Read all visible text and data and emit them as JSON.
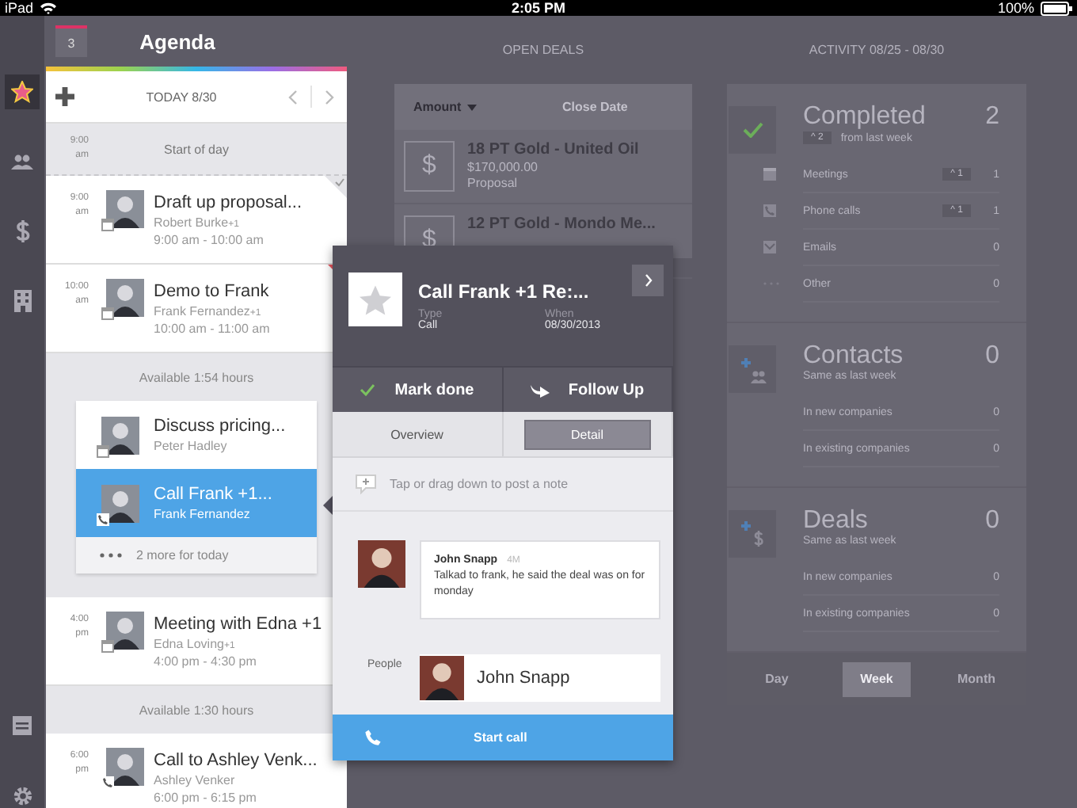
{
  "status_bar": {
    "device": "iPad",
    "time": "2:05 PM",
    "battery": "100%"
  },
  "nav_top": [
    {
      "kind": "star",
      "selected": true
    },
    {
      "kind": "contacts",
      "selected": false
    },
    {
      "kind": "dollar",
      "selected": false
    },
    {
      "kind": "building",
      "selected": false
    }
  ],
  "nav_bottom": [
    {
      "kind": "notes",
      "selected": false
    },
    {
      "kind": "settings",
      "selected": false
    }
  ],
  "agenda": {
    "badge": "3",
    "title": "Agenda",
    "date": "TODAY 8/30",
    "entries": [
      {
        "kind": "slot",
        "hour": "9:00",
        "period": "am",
        "text": "Start of day"
      },
      {
        "kind": "meeting",
        "hour": "9:00",
        "period": "am",
        "title": "Draft up proposal...",
        "person": "Robert Burke",
        "extra": "+1",
        "range": "9:00 am - 10:00 am",
        "done": true,
        "flagged": false
      },
      {
        "kind": "meeting",
        "hour": "10:00",
        "period": "am",
        "title": "Demo to Frank",
        "person": "Frank Fernandez",
        "extra": "+1",
        "range": "10:00 am - 11:00 am",
        "done": false,
        "flagged": true
      },
      {
        "kind": "available",
        "text": "Available 1:54 hours"
      },
      {
        "kind": "group",
        "items": [
          {
            "kind": "meeting",
            "title": "Discuss pricing...",
            "person": "Peter Hadley",
            "selected": false
          },
          {
            "kind": "call",
            "title": "Call Frank +1...",
            "person": "Frank Fernandez",
            "selected": true
          }
        ],
        "more": "2 more for today"
      },
      {
        "kind": "meeting",
        "hour": "4:00",
        "period": "pm",
        "title": "Meeting with Edna +1",
        "person": "Edna Loving",
        "extra": "+1",
        "range": "4:00 pm - 4:30 pm",
        "done": false,
        "flagged": false
      },
      {
        "kind": "available",
        "text": "Available 1:30 hours"
      },
      {
        "kind": "call",
        "hour": "6:00",
        "period": "pm",
        "title": "Call to Ashley Venk...",
        "person": "Ashley Venker",
        "range": "6:00 pm - 6:15 pm",
        "done": false,
        "flagged": false
      }
    ]
  },
  "open_deals": {
    "title": "OPEN DEALS",
    "columns": [
      {
        "label": "Amount",
        "sorted": true
      },
      {
        "label": "Close Date",
        "sorted": false
      }
    ],
    "rows": [
      {
        "icon": "$",
        "title": "18 PT Gold - United Oil",
        "amount": "$170,000.00",
        "stage": "Proposal"
      },
      {
        "icon": "$",
        "title": "12 PT Gold - Mondo Me..."
      }
    ]
  },
  "activity": {
    "title": "ACTIVITY 08/25 - 08/30",
    "sections": [
      {
        "kind": "completed",
        "title": "Completed",
        "count": "2",
        "change": "^ 2",
        "note": "from last week",
        "rows": [
          {
            "label": "Meetings",
            "change": "^ 1",
            "count": "1"
          },
          {
            "label": "Phone calls",
            "change": "^ 1",
            "count": "1"
          },
          {
            "label": "Emails",
            "count": "0"
          },
          {
            "label": "Other",
            "count": "0"
          }
        ]
      },
      {
        "kind": "contacts",
        "title": "Contacts",
        "count": "0",
        "note": "Same as last week",
        "rows": [
          {
            "label": "In new companies",
            "count": "0"
          },
          {
            "label": "In existing companies",
            "count": "0"
          }
        ]
      },
      {
        "kind": "deals",
        "title": "Deals",
        "count": "0",
        "note": "Same as last week",
        "rows": [
          {
            "label": "In new companies",
            "count": "0"
          },
          {
            "label": "In existing companies",
            "count": "0"
          }
        ]
      }
    ],
    "periods": [
      {
        "label": "Day",
        "selected": false
      },
      {
        "label": "Week",
        "selected": true
      },
      {
        "label": "Month",
        "selected": false
      }
    ]
  },
  "popup": {
    "title": "Call Frank +1 Re:...",
    "fields": [
      {
        "label": "Type",
        "value": "Call"
      },
      {
        "label": "When",
        "value": "08/30/2013"
      }
    ],
    "actions": [
      {
        "kind": "done",
        "label": "Mark done"
      },
      {
        "kind": "follow",
        "label": "Follow Up"
      }
    ],
    "tabs": [
      {
        "label": "Overview",
        "selected": false
      },
      {
        "label": "Detail",
        "selected": true
      }
    ],
    "note_placeholder": "Tap or drag down to post a note",
    "comment": {
      "author": "John Snapp",
      "age": "4M",
      "text": "Talkad to frank, he said the deal was on for monday"
    },
    "people_label": "People",
    "people": [
      "John Snapp"
    ],
    "start_call": "Start call"
  }
}
